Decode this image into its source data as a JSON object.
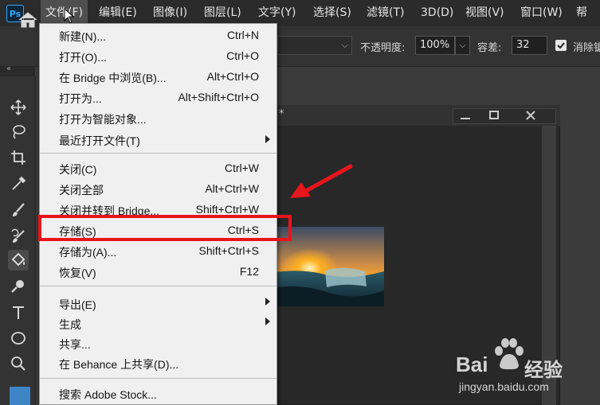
{
  "app": {
    "logo": "Ps",
    "accent": "#31a8ff"
  },
  "menubar": {
    "items": [
      {
        "label": "文件(F)"
      },
      {
        "label": "编辑(E)"
      },
      {
        "label": "图像(I)"
      },
      {
        "label": "图层(L)"
      },
      {
        "label": "文字(Y)"
      },
      {
        "label": "选择(S)"
      },
      {
        "label": "滤镜(T)"
      },
      {
        "label": "3D(D)"
      },
      {
        "label": "视图(V)"
      },
      {
        "label": "窗口(W)"
      },
      {
        "label": "帮"
      }
    ]
  },
  "options": {
    "opacity_label": "不透明度:",
    "opacity_value": "100%",
    "tolerance_label": "容差:",
    "tolerance_value": "32",
    "antialias_label": "消除锯",
    "antialias_checked": true
  },
  "document": {
    "title_suffix": "*"
  },
  "file_menu": {
    "items": [
      {
        "label": "新建(N)...",
        "shortcut": "Ctrl+N"
      },
      {
        "label": "打开(O)...",
        "shortcut": "Ctrl+O"
      },
      {
        "label": "在 Bridge 中浏览(B)...",
        "shortcut": "Alt+Ctrl+O"
      },
      {
        "label": "打开为...",
        "shortcut": "Alt+Shift+Ctrl+O"
      },
      {
        "label": "打开为智能对象...",
        "shortcut": ""
      },
      {
        "label": "最近打开文件(T)",
        "shortcut": ""
      },
      {
        "label": "关闭(C)",
        "shortcut": "Ctrl+W"
      },
      {
        "label": "关闭全部",
        "shortcut": "Alt+Ctrl+W"
      },
      {
        "label": "关闭并转到 Bridge...",
        "shortcut": "Shift+Ctrl+W"
      },
      {
        "label": "存储(S)",
        "shortcut": "Ctrl+S"
      },
      {
        "label": "存储为(A)...",
        "shortcut": "Shift+Ctrl+S"
      },
      {
        "label": "恢复(V)",
        "shortcut": "F12"
      },
      {
        "label": "导出(E)",
        "shortcut": ""
      },
      {
        "label": "生成",
        "shortcut": ""
      },
      {
        "label": "共享...",
        "shortcut": ""
      },
      {
        "label": "在 Behance 上共享(D)...",
        "shortcut": ""
      },
      {
        "label": "搜索 Adobe Stock...",
        "shortcut": ""
      }
    ],
    "highlighted_item": "存储(S)"
  },
  "annotation": {
    "highlight_color": "#e8151b"
  },
  "watermark": {
    "brand": "Bai",
    "brand2": "经验",
    "url": "jingyan.baidu.com"
  }
}
